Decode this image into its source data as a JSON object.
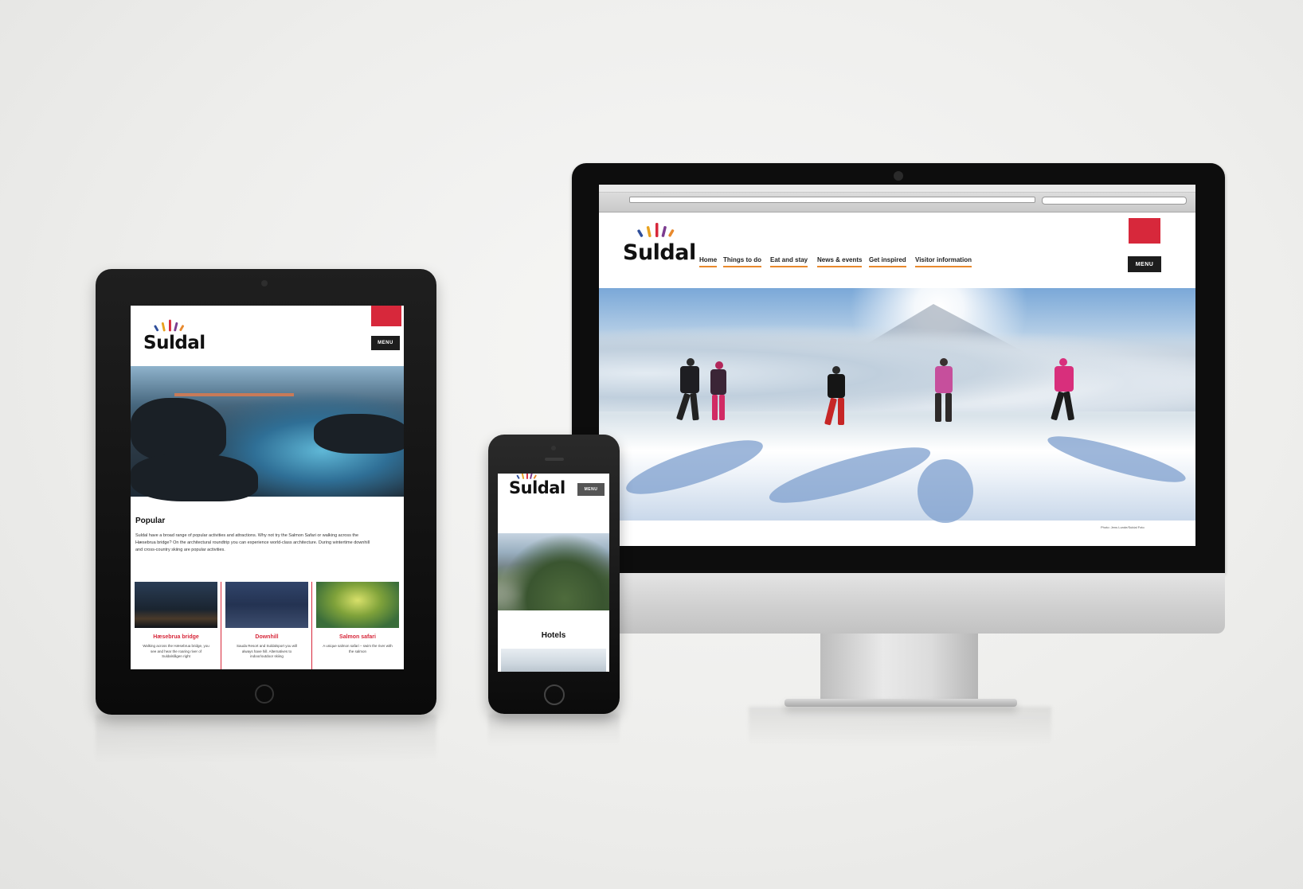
{
  "brand": {
    "name": "Suldal",
    "ray_colors": [
      "#2f4f9b",
      "#e8a21f",
      "#d7283b",
      "#7b3b8f",
      "#e8892d"
    ],
    "accent_red": "#d7283b",
    "nav_underline": "#e8892d"
  },
  "desktop": {
    "menu_label": "MENU",
    "nav": [
      {
        "label": "Home"
      },
      {
        "label": "Things to do"
      },
      {
        "label": "Eat and stay"
      },
      {
        "label": "News & events"
      },
      {
        "label": "Get inspired"
      },
      {
        "label": "Visitor information"
      }
    ],
    "photo_credit": "Photo: Jens Lunde/Suldal Foto"
  },
  "tablet": {
    "menu_label": "MENU",
    "popular": {
      "heading": "Popular",
      "body": "Suldal have a broad range of popular activities and attractions. Why not try the Salmon Safari or walking across the Hæsebrua bridge? On the architectural roundtrip you can experience world-class architecture. During wintertime downhill and cross-country skiing are popular activities."
    },
    "cards": [
      {
        "title": "Hæsebrua bridge",
        "text": "Walking across the Hæsebrua bridge, you see and hear the roaring river of Suldalslågen right"
      },
      {
        "title": "Downhill",
        "text": "Sauda Resort and Suldalsport you will always have hill. Alternatives to indoor/outdoor skiing"
      },
      {
        "title": "Salmon safari",
        "text": "A unique salmon safari – swim the river with the salmon"
      }
    ]
  },
  "phone": {
    "menu_label": "MENU",
    "section_heading": "Hotels"
  }
}
